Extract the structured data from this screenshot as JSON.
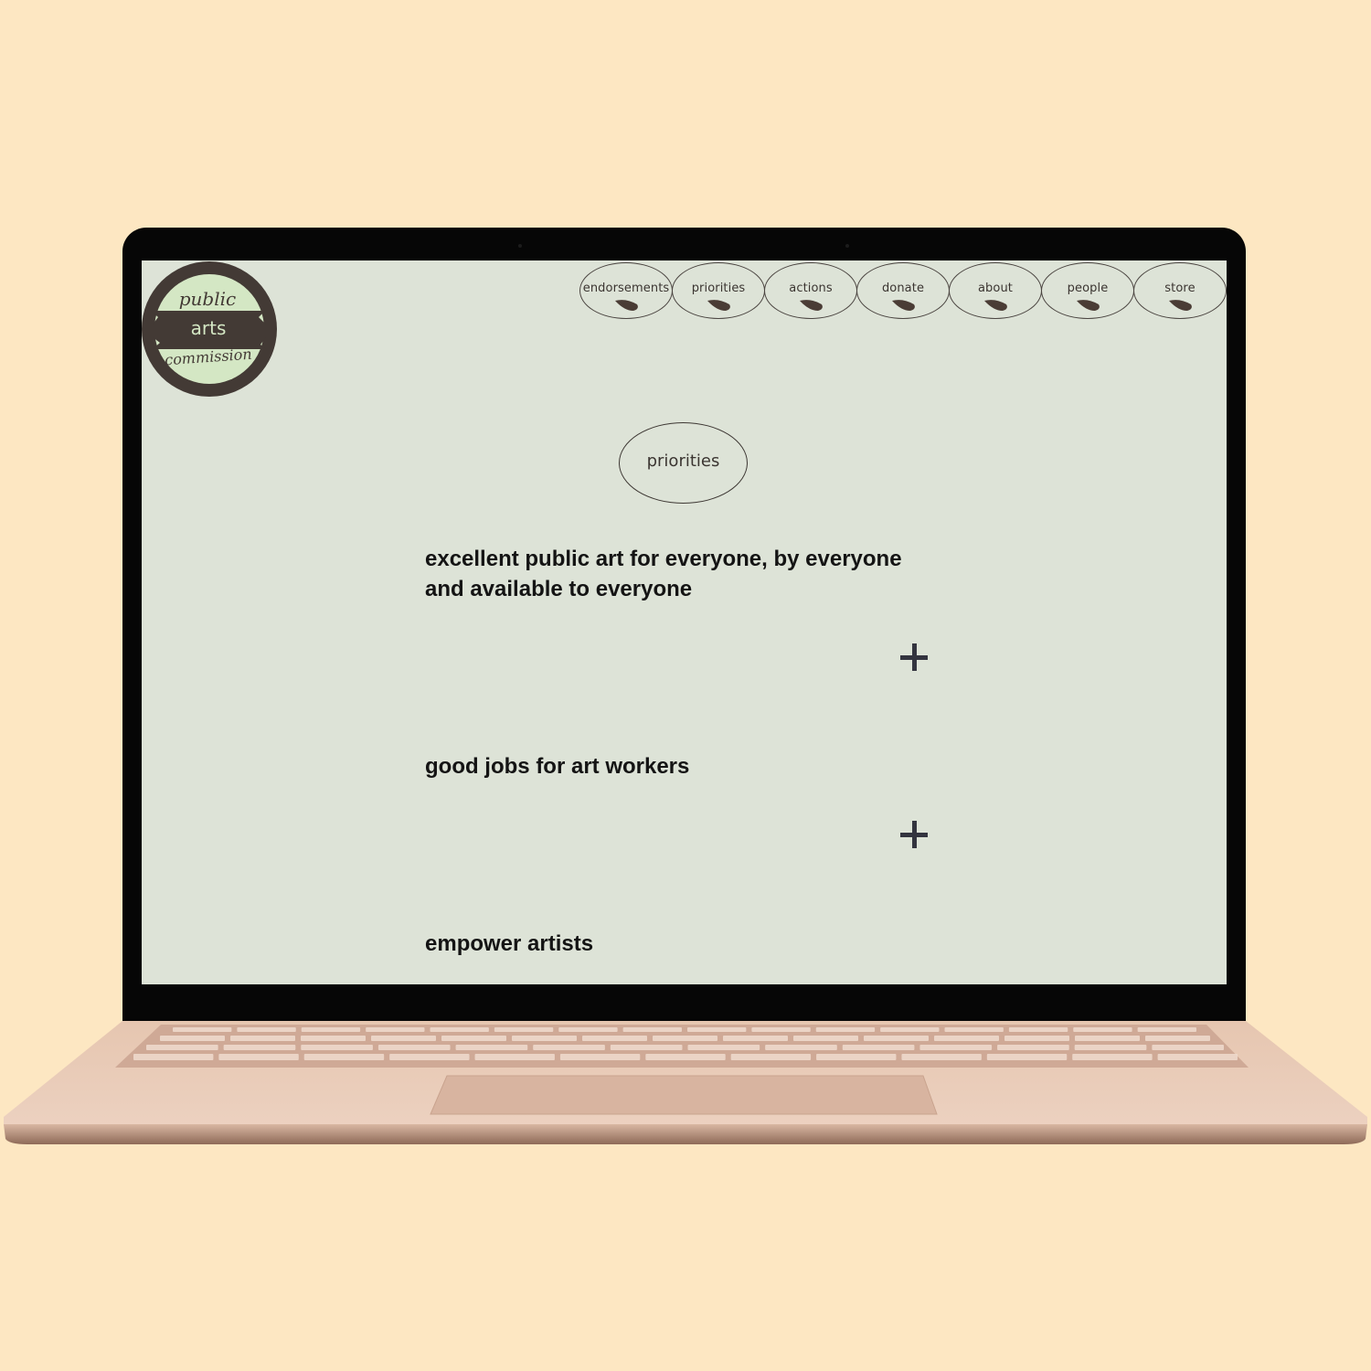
{
  "logo": {
    "line1": "public",
    "line2": "arts",
    "line3": "commission"
  },
  "nav": {
    "items": [
      {
        "label": "endorsements",
        "icon": "leaf-icon"
      },
      {
        "label": "priorities",
        "icon": "leaf-icon"
      },
      {
        "label": "actions",
        "icon": "leaf-icon"
      },
      {
        "label": "donate",
        "icon": "leaf-icon"
      },
      {
        "label": "about",
        "icon": "leaf-icon"
      },
      {
        "label": "people",
        "icon": "leaf-icon"
      },
      {
        "label": "store",
        "icon": "leaf-icon"
      }
    ]
  },
  "section": {
    "title": "priorities"
  },
  "priorities": [
    {
      "line1": "excellent public art for everyone, by everyone",
      "line2": "and available to everyone",
      "expand_icon": "plus-icon"
    },
    {
      "line1": "good jobs for art workers",
      "expand_icon": "plus-icon"
    },
    {
      "line1": "empower artists"
    }
  ],
  "colors": {
    "background": "#fde7c2",
    "screen": "#dde3d7",
    "logo_dark": "#433a35",
    "logo_light": "#d4e7c4",
    "text": "#141414",
    "laptop_body": "#e8c8b2"
  }
}
